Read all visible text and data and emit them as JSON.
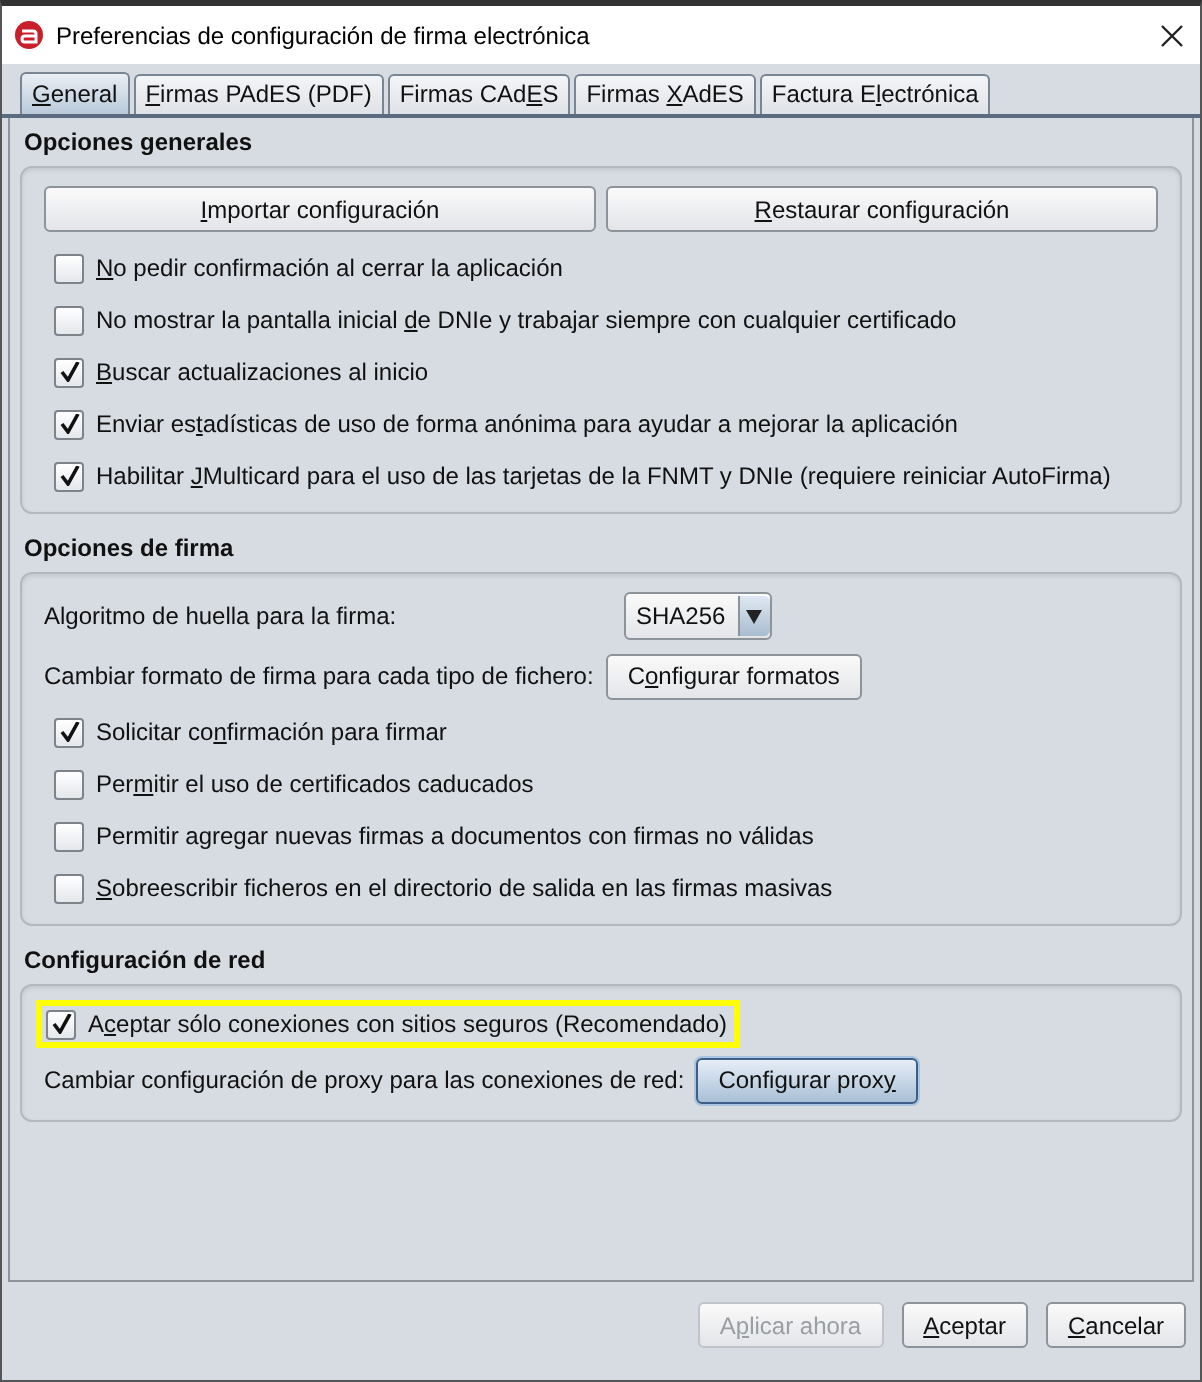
{
  "window": {
    "title": "Preferencias de configuración de firma electrónica"
  },
  "tabs": [
    {
      "label": {
        "key": "G",
        "post": "eneral"
      },
      "selected": true
    },
    {
      "label": {
        "key": "F",
        "post": "irmas PAdES (PDF)"
      },
      "selected": false
    },
    {
      "label": {
        "pre": "Firmas CAd",
        "key": "E",
        "post": "S"
      },
      "selected": false
    },
    {
      "label": {
        "pre": "Firmas ",
        "key": "X",
        "post": "AdES"
      },
      "selected": false
    },
    {
      "label": {
        "pre": "Factura E",
        "key": "l",
        "post": "ectrónica"
      },
      "selected": false
    }
  ],
  "sections": [
    {
      "title": "Opciones generales",
      "items": [
        {
          "kind": "buttons",
          "buttons": [
            {
              "label": {
                "key": "I",
                "post": "mportar configuración"
              },
              "disabled": false,
              "focused": false
            },
            {
              "label": {
                "key": "R",
                "post": "estaurar configuración"
              },
              "disabled": false,
              "focused": false
            }
          ]
        },
        {
          "kind": "checkbox",
          "label": {
            "key": "N",
            "post": "o pedir confirmación al cerrar la aplicación"
          },
          "checked": false,
          "highlighted": false
        },
        {
          "kind": "checkbox",
          "label": {
            "pre": "No mostrar la pantalla inicial ",
            "key": "d",
            "post": "e DNIe y trabajar siempre con cualquier certificado"
          },
          "checked": false,
          "highlighted": false
        },
        {
          "kind": "checkbox",
          "label": {
            "key": "B",
            "post": "uscar actualizaciones al inicio"
          },
          "checked": true,
          "highlighted": false
        },
        {
          "kind": "checkbox",
          "label": {
            "pre": "Enviar es",
            "key": "t",
            "post": "adísticas de uso de forma anónima para ayudar a mejorar la aplicación"
          },
          "checked": true,
          "highlighted": false
        },
        {
          "kind": "checkbox",
          "label": {
            "pre": "Habilitar ",
            "key": "J",
            "post": "Multicard para el uso de las tarjetas de la FNMT y DNIe (requiere reiniciar AutoFirma)"
          },
          "checked": true,
          "highlighted": false
        }
      ]
    },
    {
      "title": "Opciones de firma",
      "items": [
        {
          "kind": "combo",
          "label": "Algoritmo de huella para la firma:",
          "value": "SHA256"
        },
        {
          "kind": "labeled_button",
          "label": "Cambiar formato de firma para cada tipo de fichero:",
          "button": {
            "label": {
              "pre": "C",
              "key": "o",
              "post": "nfigurar formatos"
            },
            "disabled": false,
            "focused": false
          }
        },
        {
          "kind": "checkbox",
          "label": {
            "pre": "Solicitar co",
            "key": "n",
            "post": "firmación para firmar"
          },
          "checked": true,
          "highlighted": false
        },
        {
          "kind": "checkbox",
          "label": {
            "pre": "Per",
            "key": "m",
            "post": "itir el uso de certificados caducados"
          },
          "checked": false,
          "highlighted": false
        },
        {
          "kind": "checkbox",
          "label": {
            "pre": "Permitir agregar nuevas firmas a documentos con firmas no válidas"
          },
          "checked": false,
          "highlighted": false
        },
        {
          "kind": "checkbox",
          "label": {
            "key": "S",
            "post": "obreescribir ficheros en el directorio de salida en las firmas masivas"
          },
          "checked": false,
          "highlighted": false
        }
      ]
    },
    {
      "title": "Configuración de red",
      "items": [
        {
          "kind": "checkbox",
          "label": {
            "pre": "A",
            "key": "c",
            "post": "eptar sólo conexiones con sitios seguros (Recomendado)"
          },
          "checked": true,
          "highlighted": true
        },
        {
          "kind": "labeled_button",
          "label": "Cambiar configuración de proxy para las conexiones de red:",
          "button": {
            "label": {
              "pre": "Configurar prox",
              "key": "y"
            },
            "disabled": false,
            "focused": true
          }
        }
      ]
    }
  ],
  "footer": [
    {
      "label": {
        "pre": "A",
        "key": "p",
        "post": "licar ahora"
      },
      "disabled": true,
      "focused": false
    },
    {
      "label": {
        "key": "A",
        "post": "ceptar"
      },
      "disabled": false,
      "focused": false
    },
    {
      "label": {
        "key": "C",
        "post": "ancelar"
      },
      "disabled": false,
      "focused": false
    }
  ]
}
